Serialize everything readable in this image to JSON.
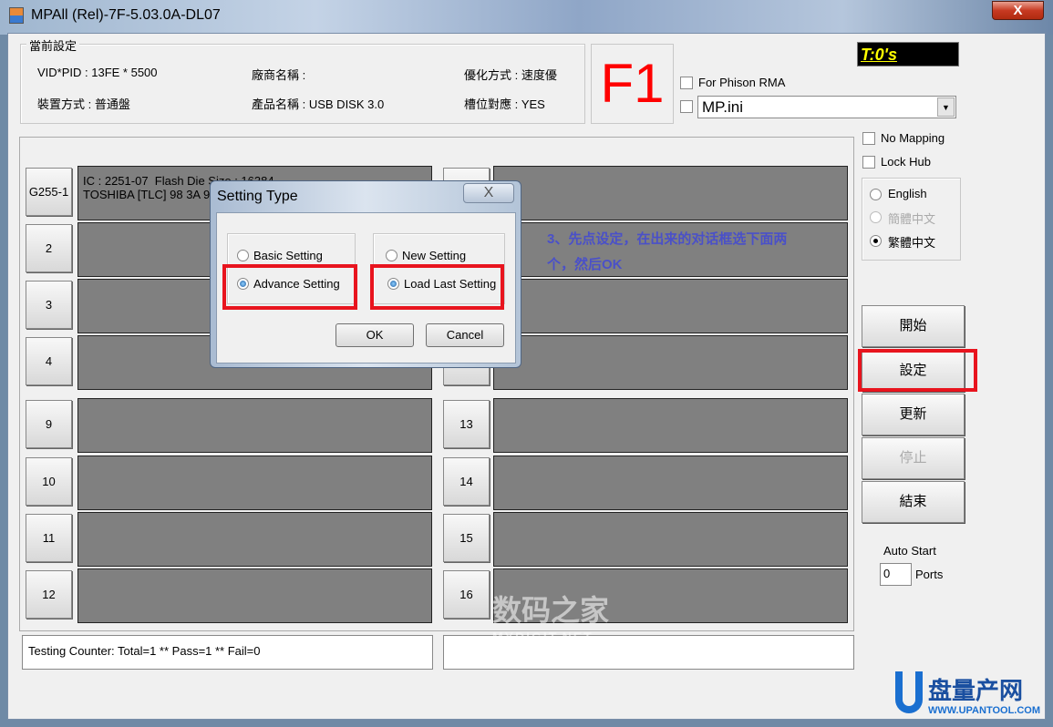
{
  "window": {
    "title": "MPAll (Rel)-7F-5.03.0A-DL07",
    "close_label": "X"
  },
  "current_settings": {
    "label": "當前設定",
    "vid_pid": "VID*PID : 13FE * 5500",
    "vendor": "廠商名稱 :",
    "optimize": "優化方式 : 速度優",
    "device_mode": "裝置方式 : 普通盤",
    "product": "產品名稱 : USB DISK 3.0",
    "slot_mapping": "槽位對應 : YES"
  },
  "f1": "F1",
  "timer": "T:0's",
  "phison_rma": {
    "label": "For Phison RMA",
    "checked": false
  },
  "ini": {
    "value": "MP.ini",
    "checked": false
  },
  "options": {
    "no_mapping": "No Mapping",
    "lock_hub": "Lock Hub"
  },
  "language": {
    "options": [
      "English",
      "簡體中文",
      "繁體中文"
    ],
    "selected": "繁體中文"
  },
  "actions": {
    "start": "開始",
    "settings": "設定",
    "refresh": "更新",
    "stop": "停止",
    "exit": "結束"
  },
  "auto_start": {
    "label": "Auto Start",
    "value": "0",
    "unit": "Ports"
  },
  "ports_left": [
    {
      "label": "G255-1",
      "info": "IC : 2251-07  Flash Die Size : 16384\nTOSHIBA [TLC] 98 3A 9"
    },
    {
      "label": "2",
      "info": ""
    },
    {
      "label": "3",
      "info": ""
    },
    {
      "label": "4",
      "info": ""
    },
    {
      "label": "9",
      "info": ""
    },
    {
      "label": "10",
      "info": ""
    },
    {
      "label": "11",
      "info": ""
    },
    {
      "label": "12",
      "info": ""
    }
  ],
  "ports_right": [
    {
      "label": "",
      "info": ""
    },
    {
      "label": "",
      "info": ""
    },
    {
      "label": "",
      "info": ""
    },
    {
      "label": "",
      "info": ""
    },
    {
      "label": "13",
      "info": ""
    },
    {
      "label": "14",
      "info": ""
    },
    {
      "label": "15",
      "info": ""
    },
    {
      "label": "16",
      "info": ""
    }
  ],
  "status": {
    "left": "Testing Counter: Total=1 ** Pass=1 ** Fail=0",
    "right": ""
  },
  "dialog": {
    "title": "Setting Type",
    "close": "X",
    "basic": "Basic Setting",
    "advance": "Advance Setting",
    "new": "New Setting",
    "load_last": "Load Last Setting",
    "ok": "OK",
    "cancel": "Cancel",
    "mode_selected": "Advance Setting",
    "source_selected": "Load Last Setting"
  },
  "annotation": {
    "line1": "3、先点设定，在出来的对话框选下面两",
    "line2": "个，然后OK",
    "color": "#4a50c8"
  },
  "watermarks": {
    "mydigit": "数码之家",
    "mydigit_url": "MYDIGIT.NET",
    "upantool": "盘量产网",
    "upantool_url": "WWW.UPANTOOL.COM"
  },
  "colors": {
    "highlight": "#e8141e",
    "port_panel": "#808080",
    "f1": "#ff0000",
    "timer_text": "#ffff00"
  }
}
